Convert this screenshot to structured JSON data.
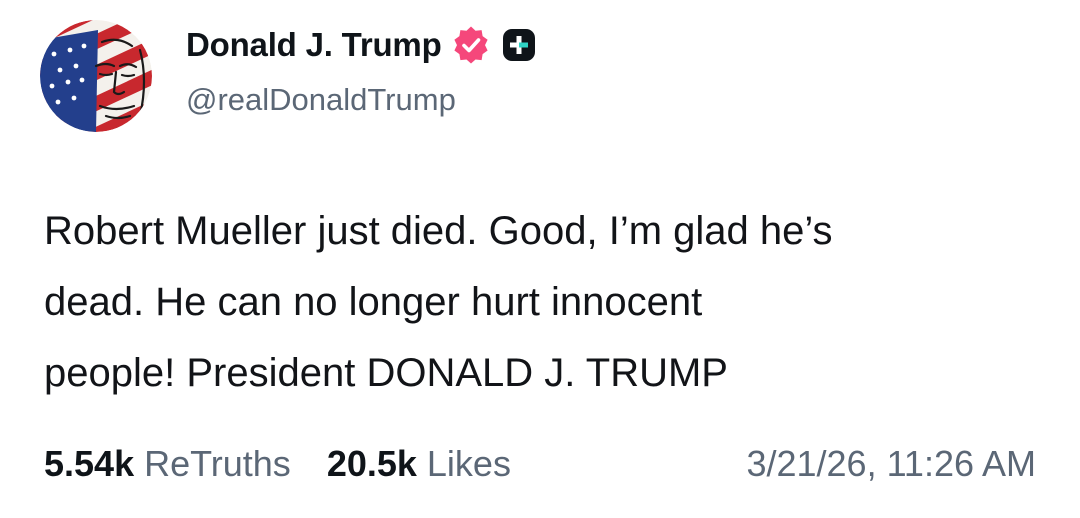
{
  "author": {
    "display_name": "Donald J. Trump",
    "handle": "@realDonaldTrump",
    "verified_icon": "verified-badge-icon",
    "plus_icon": "plus-square-icon",
    "badge_color": "#f5477b"
  },
  "post": {
    "lines": [
      "Robert Mueller just died. Good, I’m glad he’s",
      "dead. He can no longer hurt innocent",
      "people! President DONALD J. TRUMP"
    ]
  },
  "stats": {
    "retruths_count": "5.54k",
    "retruths_label": "ReTruths",
    "likes_count": "20.5k",
    "likes_label": "Likes"
  },
  "timestamp": "3/21/26, 11:26 AM",
  "colors": {
    "text": "#0f1419",
    "muted": "#5b6776",
    "background": "#ffffff"
  }
}
